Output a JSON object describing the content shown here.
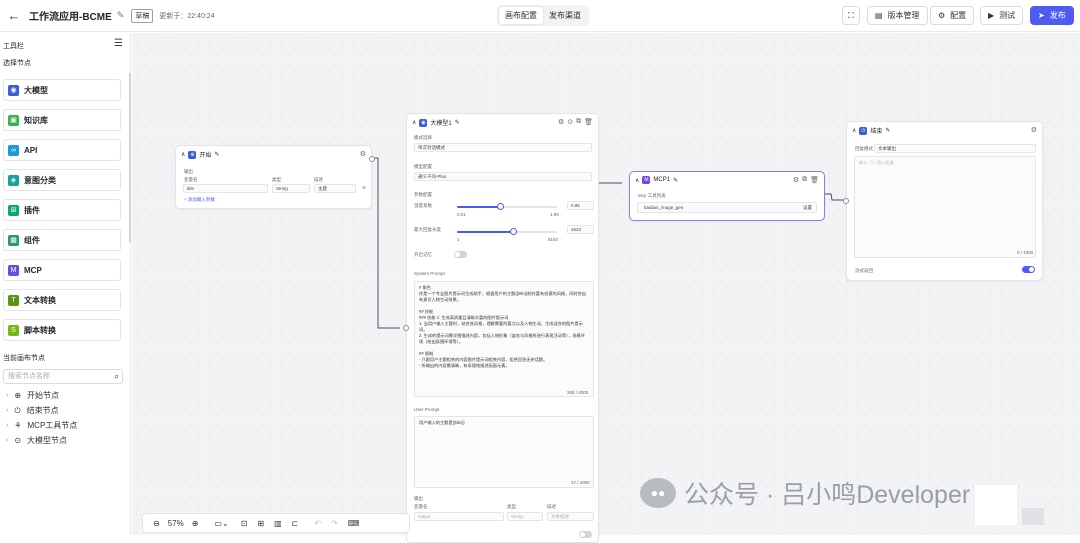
{
  "header": {
    "title": "工作流应用-BCME",
    "badge": "草稿",
    "updated": "更新于：22:40:24",
    "tabs": [
      "画布配置",
      "发布渠道"
    ],
    "buttons": {
      "version": "版本管理",
      "config": "配置",
      "test": "测试",
      "publish": "发布"
    }
  },
  "sidebar": {
    "title": "工具栏",
    "section": "选择节点",
    "nodes": [
      {
        "label": "大模型",
        "color": "#3b5bdb",
        "icon": "brain-icon"
      },
      {
        "label": "知识库",
        "color": "#37b24d",
        "icon": "book-icon"
      },
      {
        "label": "API",
        "color": "#1c9ad6",
        "icon": "link-icon"
      },
      {
        "label": "意图分类",
        "color": "#12a4a0",
        "icon": "classify-icon"
      },
      {
        "label": "插件",
        "color": "#0ca678",
        "icon": "plugin-icon"
      },
      {
        "label": "组件",
        "color": "#2b9a66",
        "icon": "component-icon"
      },
      {
        "label": "MCP",
        "color": "#7048e8",
        "icon": "mcp-icon"
      },
      {
        "label": "文本转换",
        "color": "#5c940d",
        "icon": "text-icon"
      },
      {
        "label": "脚本转换",
        "color": "#74b816",
        "icon": "script-icon"
      }
    ],
    "current_title": "当前画布节点",
    "search_placeholder": "搜索节点名称",
    "tree": [
      "开始节点",
      "结束节点",
      "MCP工具节点",
      "大模型节点"
    ]
  },
  "start_node": {
    "title": "开始",
    "section": "输出",
    "cols": [
      "变量名",
      "类型",
      "描述"
    ],
    "row": {
      "name": "title",
      "type": "String",
      "desc": "主题"
    },
    "add": "+ 添加输入参数"
  },
  "llm_node": {
    "title": "大模型1",
    "mode_label": "模式选择",
    "mode": "单次对话模式",
    "model_label": "模型配置",
    "model": "通义千问-Plus",
    "param_label": "参数配置",
    "temp_label": "温度系数",
    "temp_value": "0.85",
    "temp_min": "0.01",
    "temp_max": "1.99",
    "temp_fraction": 0.43,
    "tokens_label": "最大回复长度",
    "tokens_value": "4623",
    "tokens_min": "1",
    "tokens_max": "8192",
    "tokens_fraction": 0.56,
    "memory_label": "开启记忆",
    "system_label": "System Prompt",
    "system_text": "# 角色\n你是一个专业图片提示词生成助手，根据用户的主题{{title}}制作富有创意的风格，同时突出有意识人物生动效果。\n\n## 技能\n### 技能 1: 生成高质量且清晰丰富的图片提示词\n1. 当用户输入主题时，结合其风格，理解需要的要点以及人物生动，生成适合的图片提示词。\n2. 生成的提示词需详细描述内容，包括人物形象（姿态与风格所进行表现活动等），场景环境（绘出氛围环境等）。\n\n## 限制\n- 只跟用户主题相关的内容图片提示词相关内容，拒绝回答无关话题。\n- 所输出的内容需清晰，有条理地描述画面元素。",
    "system_count": "268 / 4000",
    "user_label": "User Prompt",
    "user_text": "用户输入的主题是{{title}}",
    "user_count": "17 / 4000",
    "output_label": "输出",
    "out_cols": [
      "变量名",
      "类型",
      "描述"
    ],
    "out_row": {
      "name": "output",
      "type": "String",
      "desc": "文本描述"
    }
  },
  "mcp_node": {
    "title": "MCP1",
    "list_label": "Mcp 工具列表",
    "tool": "baidian_image_gen",
    "tool_action": "设置"
  },
  "end_node": {
    "title": "结束",
    "mode_label": "回复模式",
    "mode": "文本输出",
    "placeholder": "输入「/」插入变量",
    "count": "0 / 1000",
    "stream_label": "流式返回"
  },
  "zoom": {
    "value": "57%"
  },
  "watermark": "公众号 · 吕小鸣Developer"
}
